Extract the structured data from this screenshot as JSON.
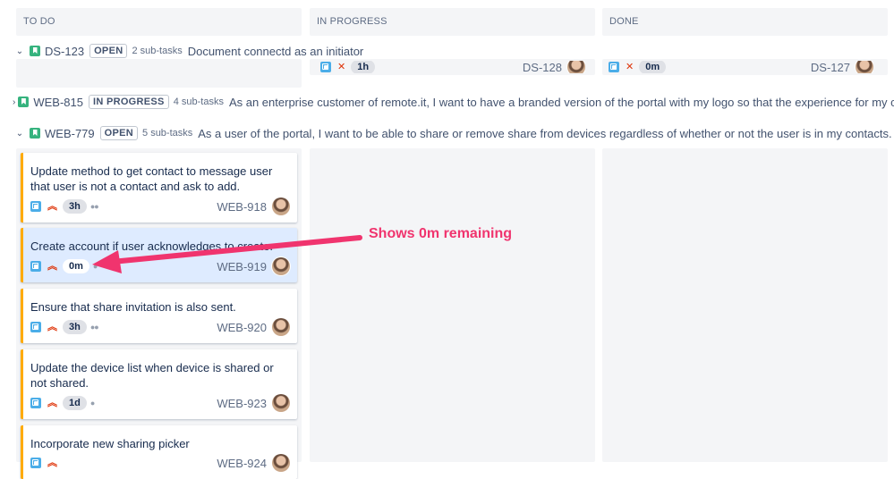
{
  "columns": [
    "TO DO",
    "IN PROGRESS",
    "DONE"
  ],
  "swimlanes": [
    {
      "chevron": "⌄",
      "key": "DS-123",
      "status": "OPEN",
      "subtasks": "2 sub-tasks",
      "summary": "Document connectd as an initiator"
    },
    {
      "chevron": "›",
      "key": "WEB-815",
      "status": "IN PROGRESS",
      "subtasks": "4 sub-tasks",
      "summary": "As an enterprise customer of remote.it, I want to have a branded version of the portal with my logo so that the experience for my customers is consistent with my brand."
    },
    {
      "chevron": "⌄",
      "key": "WEB-779",
      "status": "OPEN",
      "subtasks": "5 sub-tasks",
      "summary": "As a user of the portal, I want to be able to share or remove share from devices regardless of whether or not the user is in my contacts."
    }
  ],
  "partial_cards": [
    {
      "estimate": "1h",
      "key": "DS-128"
    },
    {
      "estimate": "0m",
      "key": "DS-127"
    }
  ],
  "cards": [
    {
      "title": "Update method to get contact to message user that user is not a contact and ask to add.",
      "estimate": "3h",
      "key": "WEB-918",
      "selected": false
    },
    {
      "title": "Create account if user acknowledges to create.",
      "estimate": "0m",
      "key": "WEB-919",
      "selected": true
    },
    {
      "title": "Ensure that share invitation is also sent.",
      "estimate": "3h",
      "key": "WEB-920",
      "selected": false
    },
    {
      "title": "Update the device list when device is shared or not shared.",
      "estimate": "1d",
      "key": "WEB-923",
      "selected": false
    },
    {
      "title": "Incorporate new sharing picker",
      "estimate": "",
      "key": "WEB-924",
      "selected": false
    }
  ],
  "annotation": {
    "text": "Shows 0m remaining",
    "color": "#f0346e"
  },
  "colors": {
    "story": "#36b37e",
    "subtask": "#4bade8",
    "priority": "#de350b",
    "card_border": "#ffab00",
    "selected_bg": "#deebff"
  },
  "icons": {
    "story": "story-icon",
    "subtask": "subtask-icon",
    "priority": "priority-highest-icon",
    "avatar": "user-avatar"
  }
}
